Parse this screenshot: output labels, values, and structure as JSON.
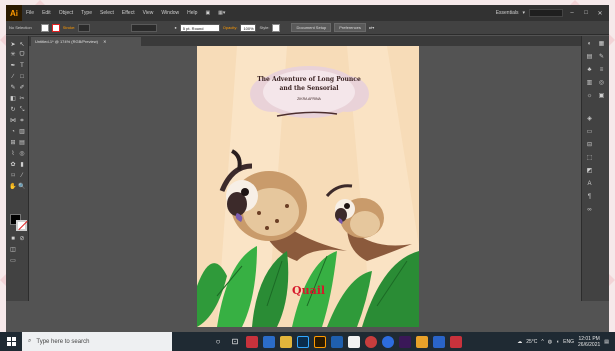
{
  "app": {
    "logo": "Ai",
    "menu": [
      "File",
      "Edit",
      "Object",
      "Type",
      "Select",
      "Effect",
      "View",
      "Window",
      "Help"
    ],
    "workspace": "Essentials"
  },
  "control_bar": {
    "selection": "No Selection",
    "stroke_label": "Stroke:",
    "brush": "5 pt. Round",
    "opacity_label": "Opacity:",
    "opacity_value": "100%",
    "style_label": "Style:",
    "document_setup": "Document Setup",
    "preferences": "Preferences"
  },
  "document": {
    "tab_label": "Untitled-1* @ 174% (RGB/Preview)"
  },
  "artwork": {
    "title_line1": "The Adventure of Long Pounce",
    "title_line2": "and the Sensorial",
    "byline": "ZIKRA AFRINA",
    "word": "Quail"
  },
  "taskbar": {
    "search_placeholder": "Type here to search",
    "weather": "25°C",
    "language": "ENG",
    "time": "12:01 PM",
    "date": "26/6/2021"
  },
  "colors": {
    "accent": "#ff9a00",
    "artboard_bg": "#f7dcb8",
    "leaf_green": "#2f9a3a",
    "taskbar": "#1f2a33"
  }
}
